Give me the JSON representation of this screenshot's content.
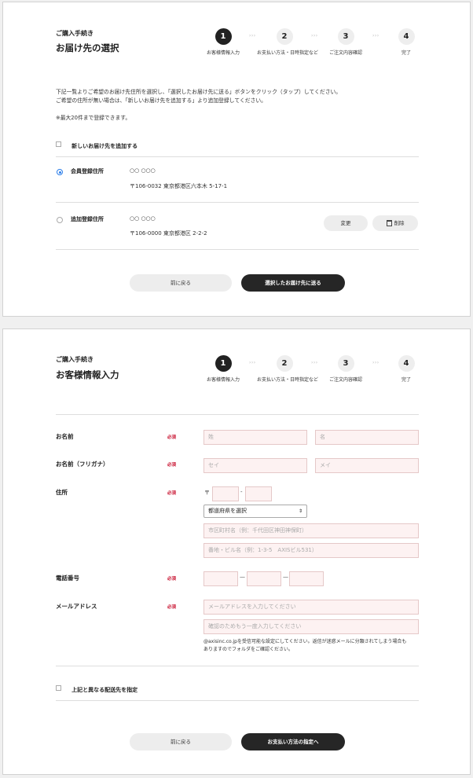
{
  "steps": [
    {
      "num": "1",
      "label": "お客様情報入力"
    },
    {
      "num": "2",
      "label": "お支払い方法・日時指定など"
    },
    {
      "num": "3",
      "label": "ご注文内容確認"
    },
    {
      "num": "4",
      "label": "完了"
    }
  ],
  "arrow": "›››",
  "panel1": {
    "kicker": "ご購入手続き",
    "title": "お届け先の選択",
    "intro_line1": "下記一覧よりご希望のお届け先住所を選択し、「選択したお届け先に送る」ボタンをクリック（タップ）してください。",
    "intro_line2": "ご希望の住所が無い場合は、「新しいお届け先を追加する」より追加登録してください。",
    "note": "※最大20件まで登録できます。",
    "add_new": "新しいお届け先を追加する",
    "addresses": [
      {
        "type": "会員登録住所",
        "name": "○○ ○○○",
        "address": "〒106-0032 東京都港区六本木 5-17-1",
        "selected": true
      },
      {
        "type": "追加登録住所",
        "name": "○○ ○○○",
        "address": "〒106-0000 東京都港区 2-2-2",
        "selected": false
      }
    ],
    "edit_label": "変更",
    "delete_label": "削除",
    "back_label": "前に戻る",
    "send_label": "選択したお届け先に送る"
  },
  "panel2": {
    "kicker": "ご購入手続き",
    "title": "お客様情報入力",
    "required": "必須",
    "name_label": "お名前",
    "last_name_ph": "姓",
    "first_name_ph": "名",
    "kana_label": "お名前（フリガナ）",
    "last_kana_ph": "セイ",
    "first_kana_ph": "メイ",
    "address_label": "住所",
    "postal_mark": "〒",
    "prefecture": "都道府県を選択",
    "city_ph": "市区町村名（例：千代田区神田神保町）",
    "street_ph": "番地・ビル名（例：1-3-5　AXISビル531）",
    "phone_label": "電話番号",
    "email_label": "メールアドレス",
    "email_ph": "メールアドレスを入力してください",
    "email_confirm_ph": "確認のためもう一度入力してください",
    "email_note1": "@axisinc.co.jpを受信可能な設定にしてください。返信が迷惑メールに分類されてしまう場合も",
    "email_note2": "ありますのでフォルダをご確認ください。",
    "diff_ship": "上記と異なる配送先を指定",
    "back_label": "前に戻る",
    "next_label": "お支払い方法の指定へ"
  }
}
